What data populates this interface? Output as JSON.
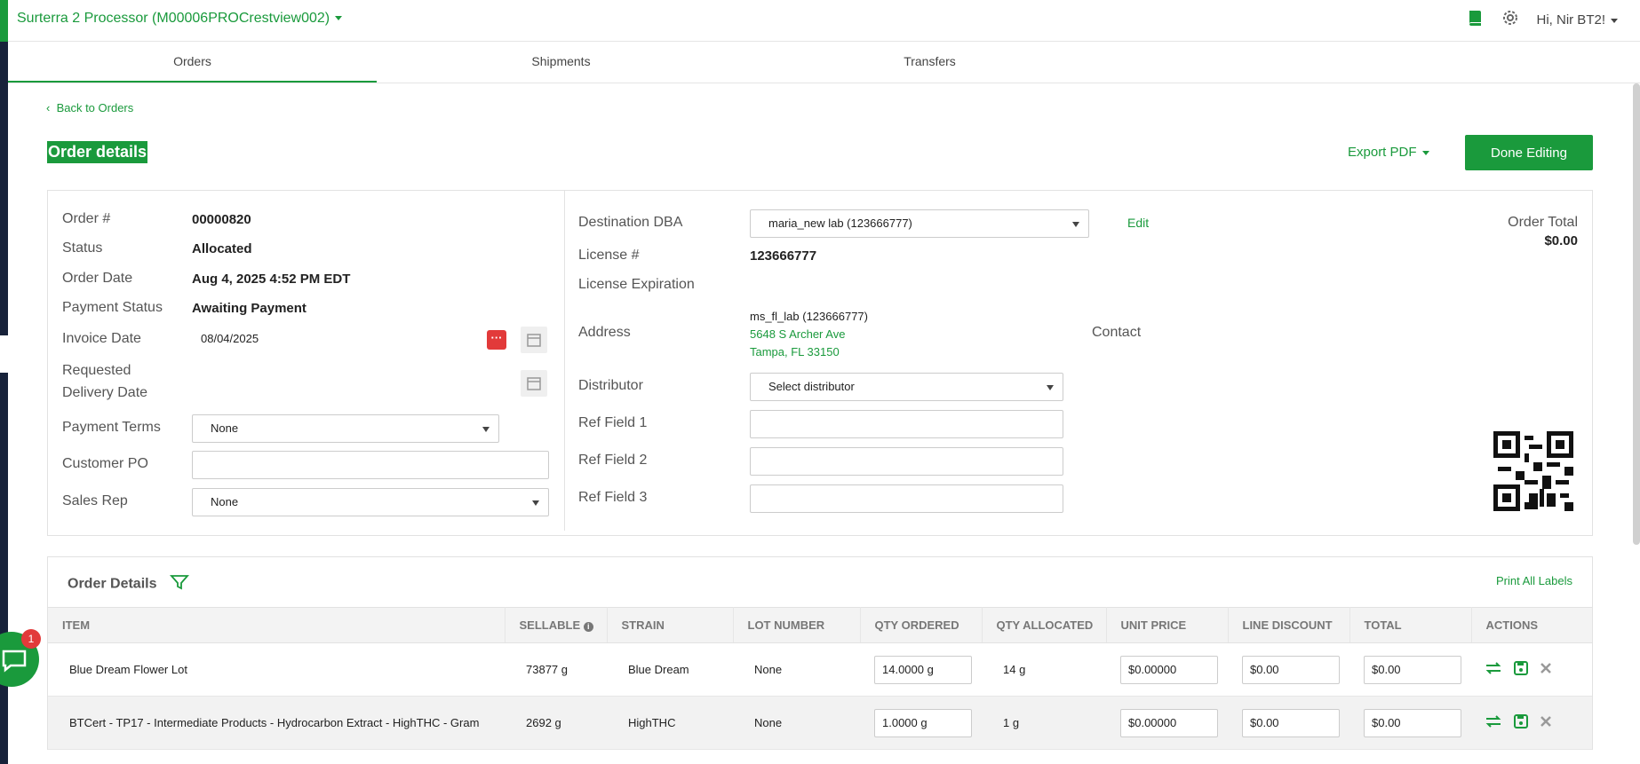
{
  "header": {
    "facility": "Surterra 2 Processor (M00006PROCrestview002)",
    "greeting": "Hi, Nir BT2!"
  },
  "tabs": [
    "Orders",
    "Shipments",
    "Transfers"
  ],
  "back_link": "Back to Orders",
  "page_title": "Order details",
  "export_pdf": "Export PDF",
  "done_editing": "Done Editing",
  "left": {
    "order_no_label": "Order #",
    "order_no": "00000820",
    "status_label": "Status",
    "status": "Allocated",
    "order_date_label": "Order Date",
    "order_date": "Aug 4, 2025 4:52 PM EDT",
    "payment_status_label": "Payment Status",
    "payment_status": "Awaiting Payment",
    "invoice_date_label": "Invoice Date",
    "invoice_date": "08/04/2025",
    "requested_label_1": "Requested",
    "requested_label_2": "Delivery Date",
    "payment_terms_label": "Payment Terms",
    "payment_terms": "None",
    "customer_po_label": "Customer PO",
    "sales_rep_label": "Sales Rep",
    "sales_rep": "None"
  },
  "right": {
    "dest_label": "Destination DBA",
    "dest": "maria_new lab (123666777)",
    "edit": "Edit",
    "license_label": "License #",
    "license": "123666777",
    "license_exp_label": "License Expiration",
    "address_label": "Address",
    "address_name": "ms_fl_lab (123666777)",
    "address_line1": "5648 S Archer Ave",
    "address_line2": "Tampa, FL 33150",
    "contact_label": "Contact",
    "distributor_label": "Distributor",
    "distributor": "Select distributor",
    "ref1_label": "Ref Field 1",
    "ref2_label": "Ref Field 2",
    "ref3_label": "Ref Field 3",
    "order_total_label": "Order Total",
    "order_total": "$0.00"
  },
  "details": {
    "title": "Order Details",
    "print_all": "Print All Labels",
    "columns": [
      "ITEM",
      "SELLABLE",
      "STRAIN",
      "LOT NUMBER",
      "QTY ORDERED",
      "QTY ALLOCATED",
      "UNIT PRICE",
      "LINE DISCOUNT",
      "TOTAL",
      "ACTIONS"
    ],
    "rows": [
      {
        "item": "Blue Dream Flower Lot",
        "sellable": "73877 g",
        "strain": "Blue Dream",
        "lot": "None",
        "qty_ordered": "14.0000 g",
        "qty_allocated": "14 g",
        "unit_price": "$0.00000",
        "line_discount": "$0.00",
        "total": "$0.00"
      },
      {
        "item": "BTCert - TP17 - Intermediate Products - Hydrocarbon Extract - HighTHC - Gram",
        "sellable": "2692 g",
        "strain": "HighTHC",
        "lot": "None",
        "qty_ordered": "1.0000 g",
        "qty_allocated": "1 g",
        "unit_price": "$0.00000",
        "line_discount": "$0.00",
        "total": "$0.00"
      }
    ]
  },
  "chat_badge": "1"
}
